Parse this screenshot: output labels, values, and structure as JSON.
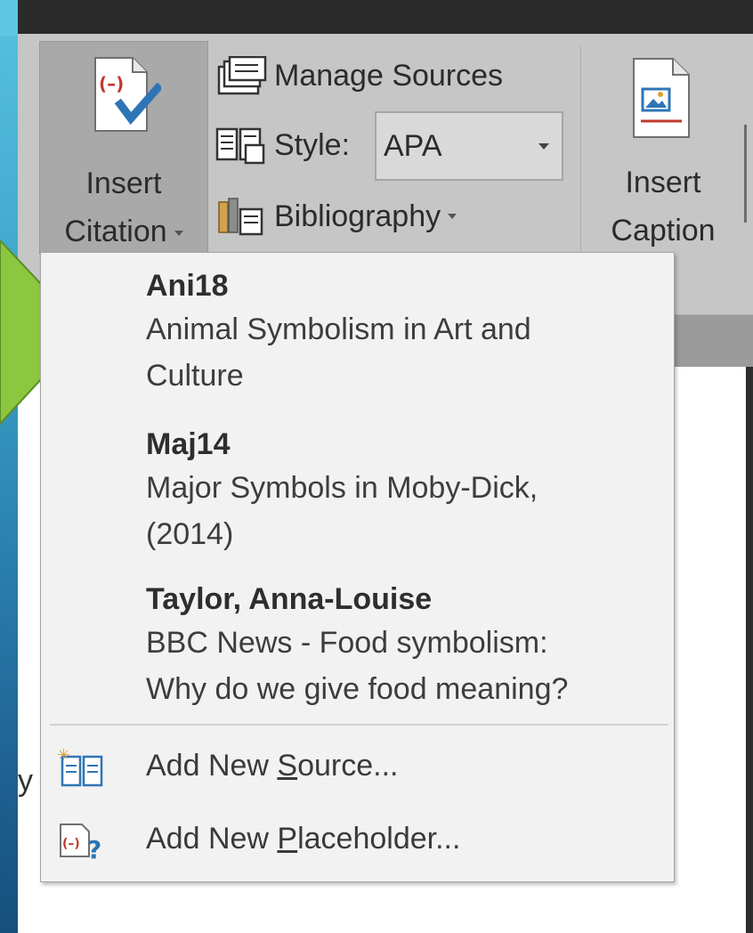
{
  "ribbon": {
    "insert_citation": {
      "line1": "Insert",
      "line2": "Citation"
    },
    "manage_sources": "Manage Sources",
    "style_label": "Style:",
    "style_value": "APA",
    "bibliography": "Bibliography",
    "insert_caption": {
      "line1": "Insert",
      "line2": "Caption"
    }
  },
  "citation_menu": {
    "sources": [
      {
        "tag": "Ani18",
        "title_lines": [
          "Animal Symbolism in Art and",
          "Culture"
        ]
      },
      {
        "tag": "Maj14",
        "title_lines": [
          "Major Symbols in Moby-Dick,",
          "(2014)"
        ]
      },
      {
        "tag": "Taylor, Anna-Louise",
        "title_lines": [
          "BBC News - Food symbolism:",
          "Why do we give food meaning?"
        ]
      }
    ],
    "add_source": {
      "before": "Add New ",
      "key": "S",
      "after": "ource..."
    },
    "add_placeholder": {
      "before": "Add New ",
      "key": "P",
      "after": "laceholder..."
    }
  },
  "document": {
    "fragment": "y"
  },
  "colors": {
    "ribbon_bg": "#c6c6c6",
    "menu_bg": "#f2f2f2",
    "arrow": "#8dc63f",
    "check_blue": "#2e75b6",
    "citation_red": "#c0392b"
  }
}
